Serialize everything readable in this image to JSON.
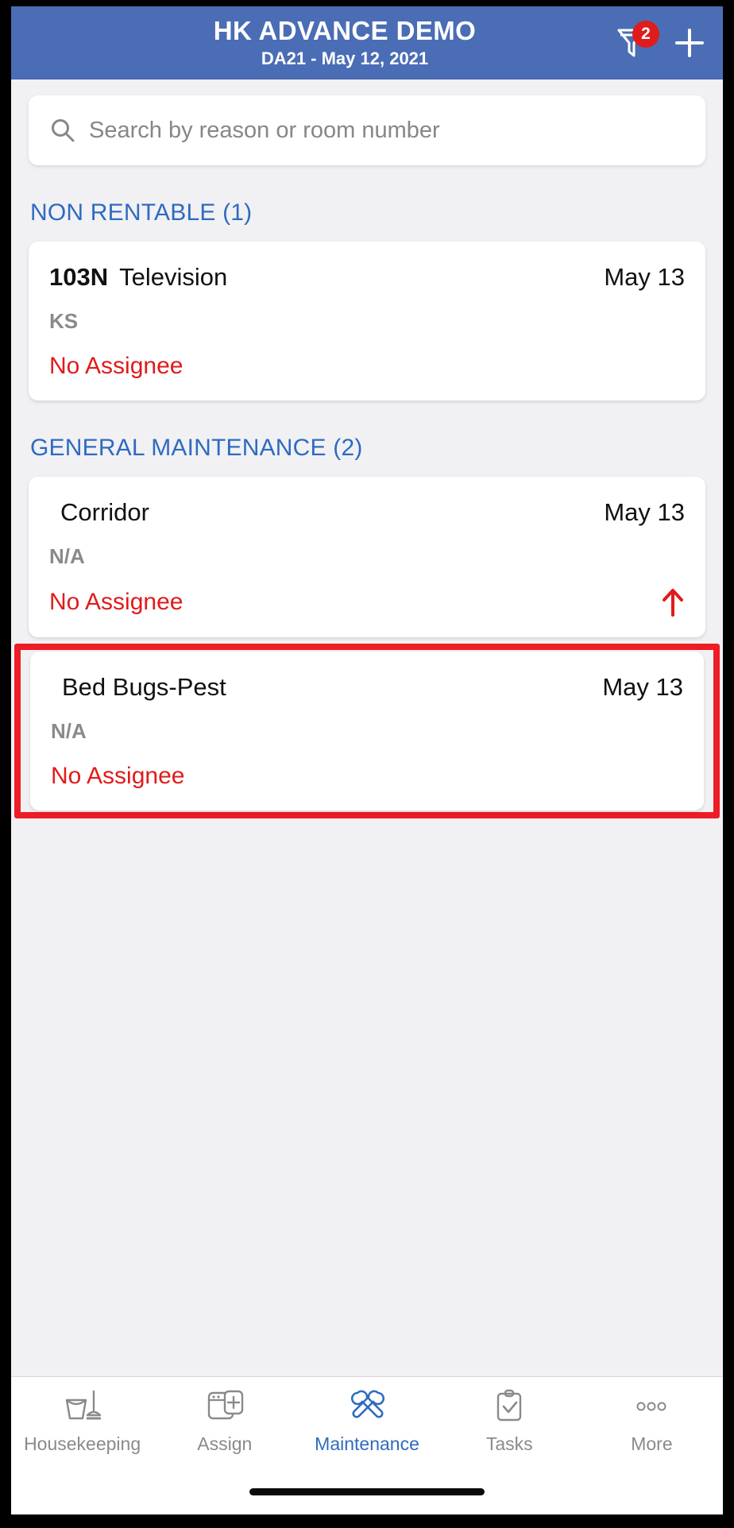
{
  "header": {
    "title": "HK ADVANCE DEMO",
    "subtitle": "DA21 - May 12, 2021",
    "filter_icon": "filter-funnel-icon",
    "filter_badge": "2",
    "add_icon": "plus-icon",
    "background_color": "#4a6db5"
  },
  "search": {
    "icon": "search-icon",
    "placeholder": "Search by reason or room number",
    "value": ""
  },
  "sections": [
    {
      "title": "NON RENTABLE (1)",
      "items": [
        {
          "room": "103N",
          "reason": "Television",
          "date": "May 13",
          "sub": "KS",
          "assignee": "No Assignee",
          "priority": "",
          "highlighted": "false"
        }
      ]
    },
    {
      "title": "GENERAL MAINTENANCE (2)",
      "items": [
        {
          "room": "",
          "reason": "Corridor",
          "date": "May 13",
          "sub": "N/A",
          "assignee": "No Assignee",
          "priority": "arrow-up-icon",
          "highlighted": "false"
        },
        {
          "room": "",
          "reason": "Bed Bugs-Pest",
          "date": "May 13",
          "sub": "N/A",
          "assignee": "No Assignee",
          "priority": "",
          "highlighted": "true"
        }
      ]
    }
  ],
  "colors": {
    "accent_blue": "#2f6bbf",
    "alert_red": "#e01b1b",
    "annotation_red": "#ee1c25",
    "muted_gray": "#8a8a8e"
  },
  "tabbar": {
    "items": [
      {
        "label": "Housekeeping",
        "icon": "bucket-mop-icon",
        "active": "false"
      },
      {
        "label": "Assign",
        "icon": "assign-card-plus-icon",
        "active": "false"
      },
      {
        "label": "Maintenance",
        "icon": "wrench-hammer-icon",
        "active": "true"
      },
      {
        "label": "Tasks",
        "icon": "clipboard-check-icon",
        "active": "false"
      },
      {
        "label": "More",
        "icon": "ellipsis-icon",
        "active": "false"
      }
    ]
  }
}
